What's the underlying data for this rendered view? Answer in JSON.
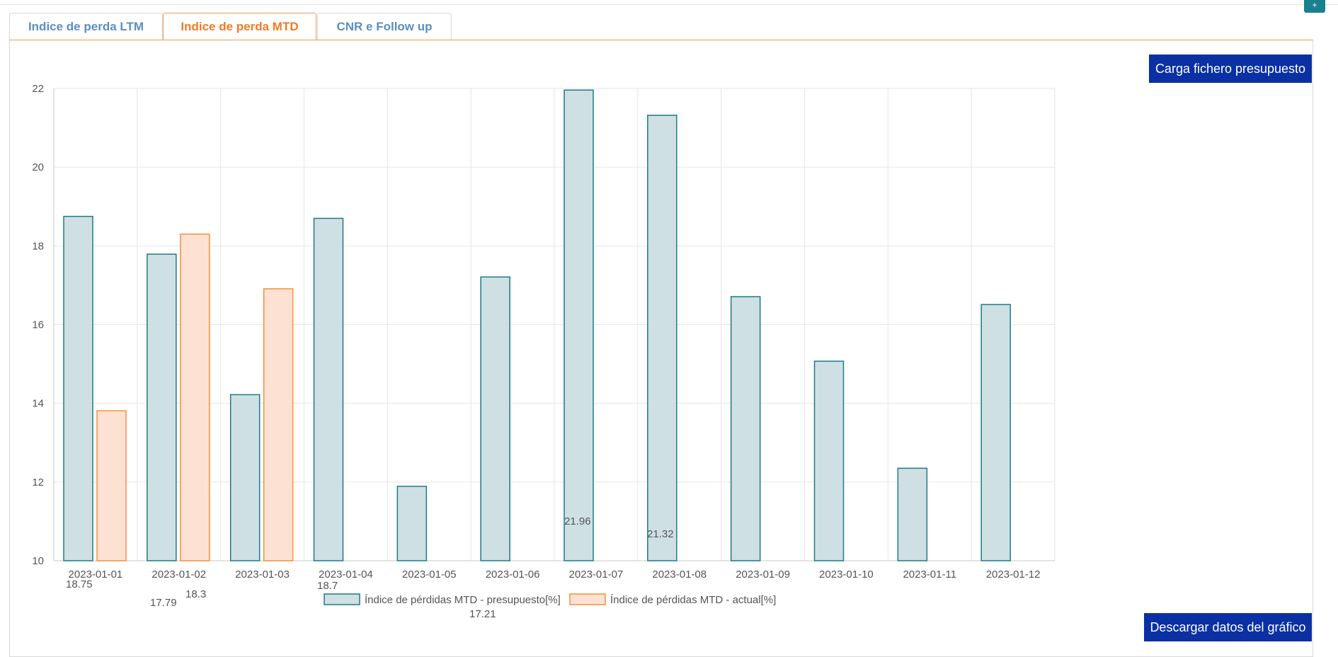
{
  "tabs": [
    {
      "label": "Indice de perda LTM",
      "active": false
    },
    {
      "label": "Indice de perda MTD",
      "active": true
    },
    {
      "label": "CNR e Follow up",
      "active": false
    }
  ],
  "corner_button": {
    "label": "+"
  },
  "buttons": {
    "upload_budget": "Carga fichero presupuesto",
    "download_data": "Descargar datos del gráfico"
  },
  "colors": {
    "budget_fill": "#cfe0e4",
    "budget_stroke": "#1f7a86",
    "actual_fill": "#fde2d3",
    "actual_stroke": "#f0913f",
    "accent": "#f07b28",
    "button": "#0a30a3"
  },
  "chart_data": {
    "type": "bar",
    "categories": [
      "2023-01-01",
      "2023-01-02",
      "2023-01-03",
      "2023-01-04",
      "2023-01-05",
      "2023-01-06",
      "2023-01-07",
      "2023-01-08",
      "2023-01-09",
      "2023-01-10",
      "2023-01-11",
      "2023-01-12"
    ],
    "series": [
      {
        "name": "Índice de pérdidas MTD - presupuesto[%]",
        "values": [
          18.75,
          17.79,
          14.22,
          18.7,
          11.89,
          17.21,
          21.96,
          21.32,
          16.71,
          15.07,
          12.35,
          16.51
        ]
      },
      {
        "name": "Índice de pérdidas MTD - actual[%]",
        "values": [
          13.81,
          18.3,
          16.91,
          null,
          null,
          null,
          null,
          null,
          null,
          null,
          null,
          null
        ]
      }
    ],
    "data_labels": [
      {
        "text": "18.75"
      },
      {
        "text": "17.79"
      },
      {
        "text": "18.3"
      },
      {
        "text": "18.7"
      },
      {
        "text": "17.21"
      },
      {
        "text": "21.96"
      },
      {
        "text": "21.32"
      }
    ],
    "y_ticks": [
      10,
      12,
      14,
      16,
      18,
      20,
      22
    ],
    "ylim": [
      10,
      22
    ],
    "grid": true,
    "legend_position": "bottom"
  }
}
